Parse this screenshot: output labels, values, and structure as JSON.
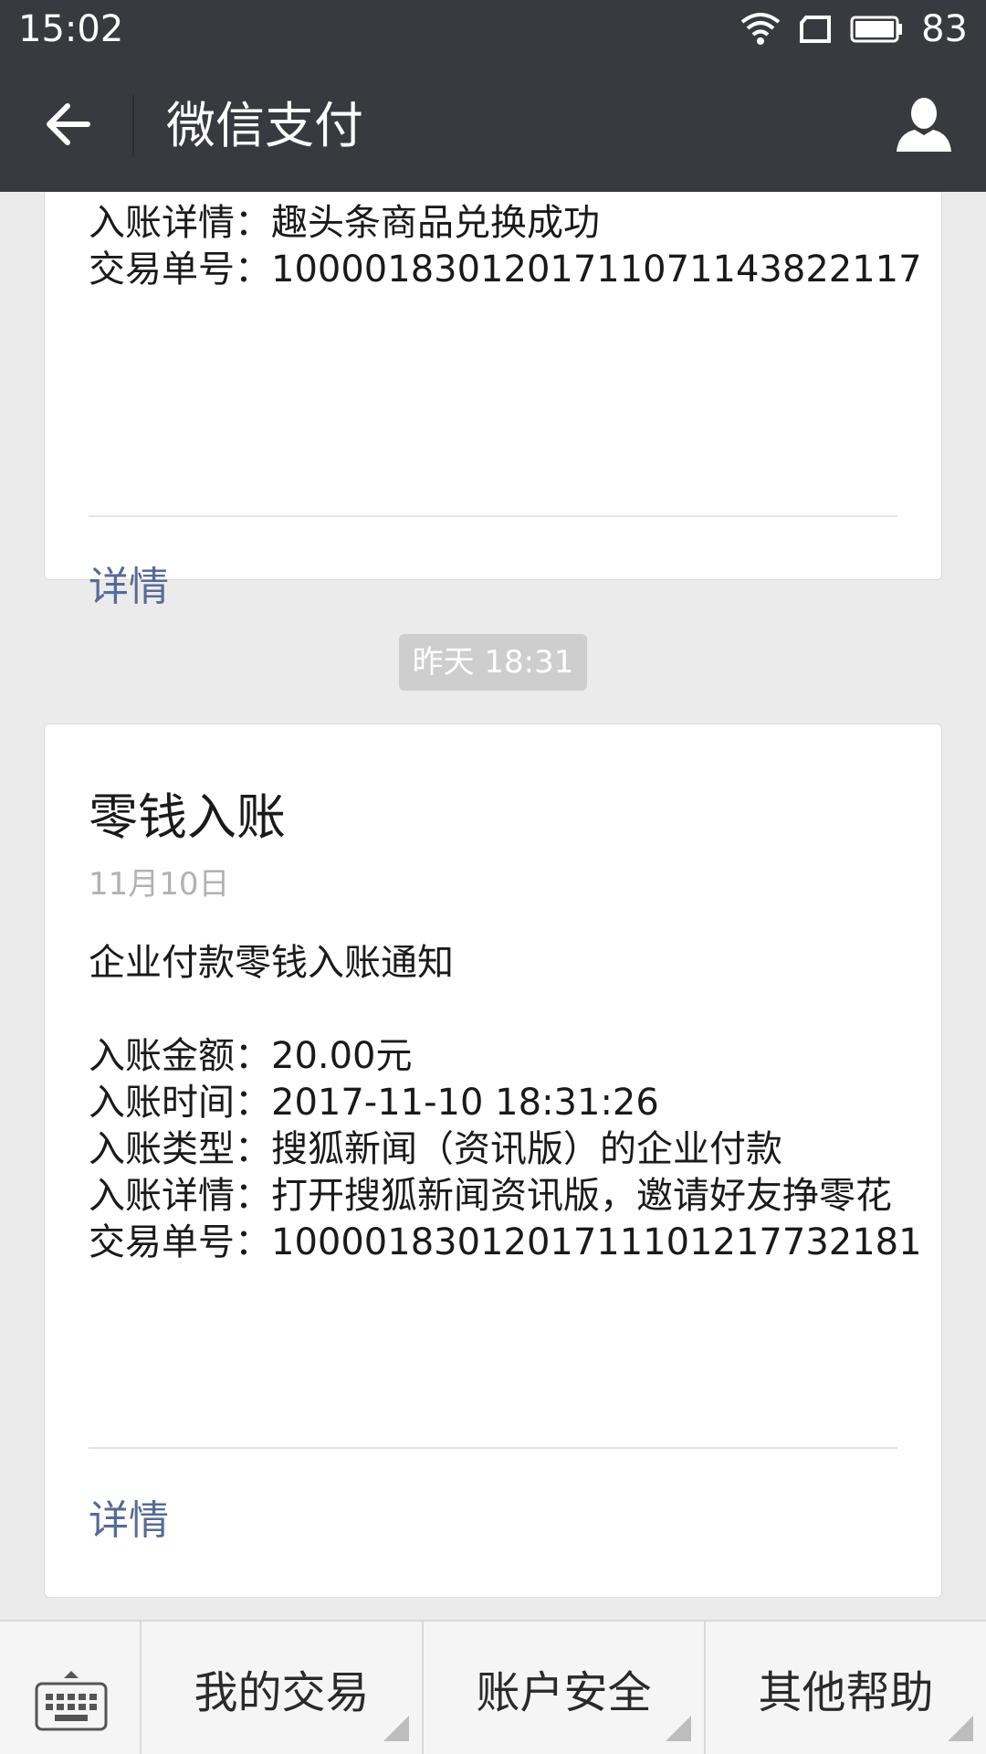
{
  "status_bar": {
    "time": "15:02",
    "battery": "83"
  },
  "title_bar": {
    "title": "微信支付"
  },
  "card1": {
    "lines": [
      "入账详情：趣头条商品兑换成功",
      "交易单号：100001830120171107114382211​7"
    ],
    "detail_label": "详情"
  },
  "timestamp": "昨天 18:31",
  "card2": {
    "title": "零钱入账",
    "date": "11月10日",
    "intro": "企业付款零钱入账通知",
    "lines": [
      "入账金额：20.00元",
      "入账时间：2017-11-10 18:31:26",
      "入账类型：搜狐新闻（资讯版）的企业付款",
      "入账详情：打开搜狐新闻资讯版，邀请好友挣零花",
      "交易单号：1000018301201711101217732181"
    ],
    "detail_label": "详情"
  },
  "bottom_menu": {
    "items": [
      "我的交易",
      "账户安全",
      "其他帮助"
    ]
  }
}
